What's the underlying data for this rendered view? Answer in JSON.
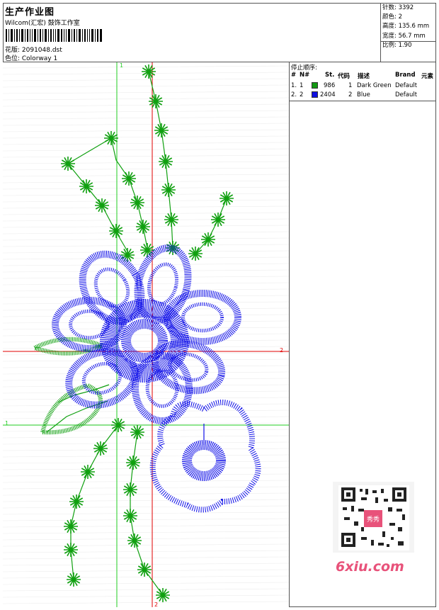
{
  "header": {
    "title": "生产作业图",
    "studio": "Wilcom(汇宏) 鼓饰工作室",
    "design_label": "花版: 2091048.dst",
    "colorway_label": "色位: Colorway 1"
  },
  "stats": {
    "stitches": "针数: 3392",
    "colors": "颜色: 2",
    "height": "高度: 135.6 mm",
    "width": "宽度: 56.7 mm",
    "scale": "比例: 1.90"
  },
  "canvas": {
    "markers": {
      "v1": "1",
      "h1": "1",
      "h2": "2",
      "v2": "2"
    },
    "colors": {
      "green": "#10a010",
      "blue": "#1010e8",
      "red": "#e00000",
      "guide_green": "#22cc22"
    }
  },
  "stop_sequence": {
    "heading": "停止顺序:",
    "columns": [
      "#",
      "N#",
      "St.",
      "代码",
      "描述",
      "Brand",
      "元素"
    ],
    "rows": [
      {
        "num": "1.",
        "n": "1",
        "swatch": "#129812",
        "stitches": "986",
        "code": "1",
        "desc": "Dark Green",
        "brand": "Default"
      },
      {
        "num": "2.",
        "n": "2",
        "swatch": "#1010e0",
        "stitches": "2404",
        "code": "2",
        "desc": "Blue",
        "brand": "Default"
      }
    ]
  },
  "watermark": {
    "text": "6xiu.com",
    "qr_label": "秀秀"
  }
}
